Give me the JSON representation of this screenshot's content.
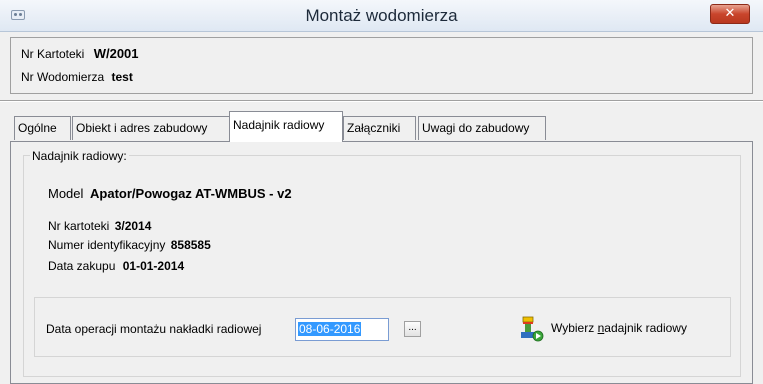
{
  "window": {
    "title": "Montaż wodomierza",
    "close_label": "✕"
  },
  "header": {
    "card_label": "Nr Kartoteki",
    "card_value": "W/2001",
    "meter_label": "Nr Wodomierza",
    "meter_value": "test"
  },
  "tabs": [
    {
      "label": "Ogólne"
    },
    {
      "label": "Obiekt i adres zabudowy"
    },
    {
      "label": "Nadajnik radiowy"
    },
    {
      "label": "Załączniki"
    },
    {
      "label": "Uwagi do zabudowy"
    }
  ],
  "radio": {
    "group_title": "Nadajnik radiowy:",
    "model_label": "Model",
    "model_value": "Apator/Powogaz AT-WMBUS - v2",
    "card_label": "Nr kartoteki",
    "card_value": "3/2014",
    "id_label": "Numer identyfikacyjny",
    "id_value": "858585",
    "purchase_label": "Data zakupu",
    "purchase_value": "01-01-2014",
    "date_label": "Data operacji montażu nakładki radiowej",
    "date_value": "08-06-2016",
    "dots_label": "...",
    "pick_pre": "Wybierz ",
    "pick_hotkey": "n",
    "pick_post": "adajnik radiowy",
    "pick_icon": "radio-transmitter-icon"
  },
  "colors": {
    "selection": "#3399ff",
    "close_button": "#c9452c"
  }
}
